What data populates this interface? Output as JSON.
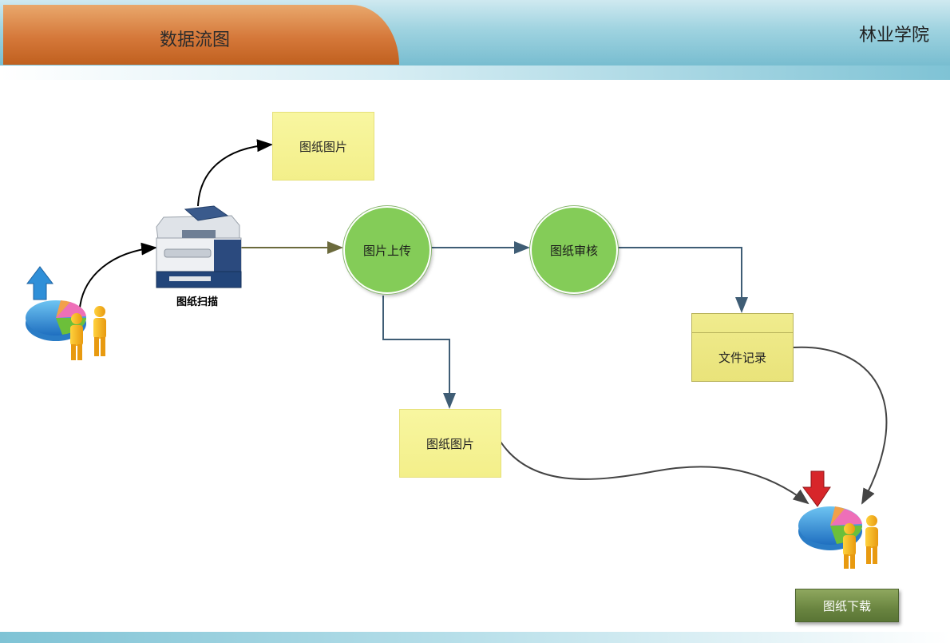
{
  "header": {
    "title": "数据流图",
    "org": "林业学院"
  },
  "nodes": {
    "scan_label": "图纸扫描",
    "image_top": "图纸图片",
    "upload": "图片上传",
    "review": "图纸审核",
    "record": "文件记录",
    "image_bottom": "图纸图片"
  },
  "download_button": "图纸下载",
  "icons": [
    "upload-users-chart-icon",
    "scanner-icon",
    "download-users-chart-icon"
  ],
  "colors": {
    "header_tab": "#d5783a",
    "node_green": "#84cc58",
    "note_yellow": "#f3ef8a",
    "button_green": "#6a8540",
    "flow_line": "#3f5d75"
  }
}
